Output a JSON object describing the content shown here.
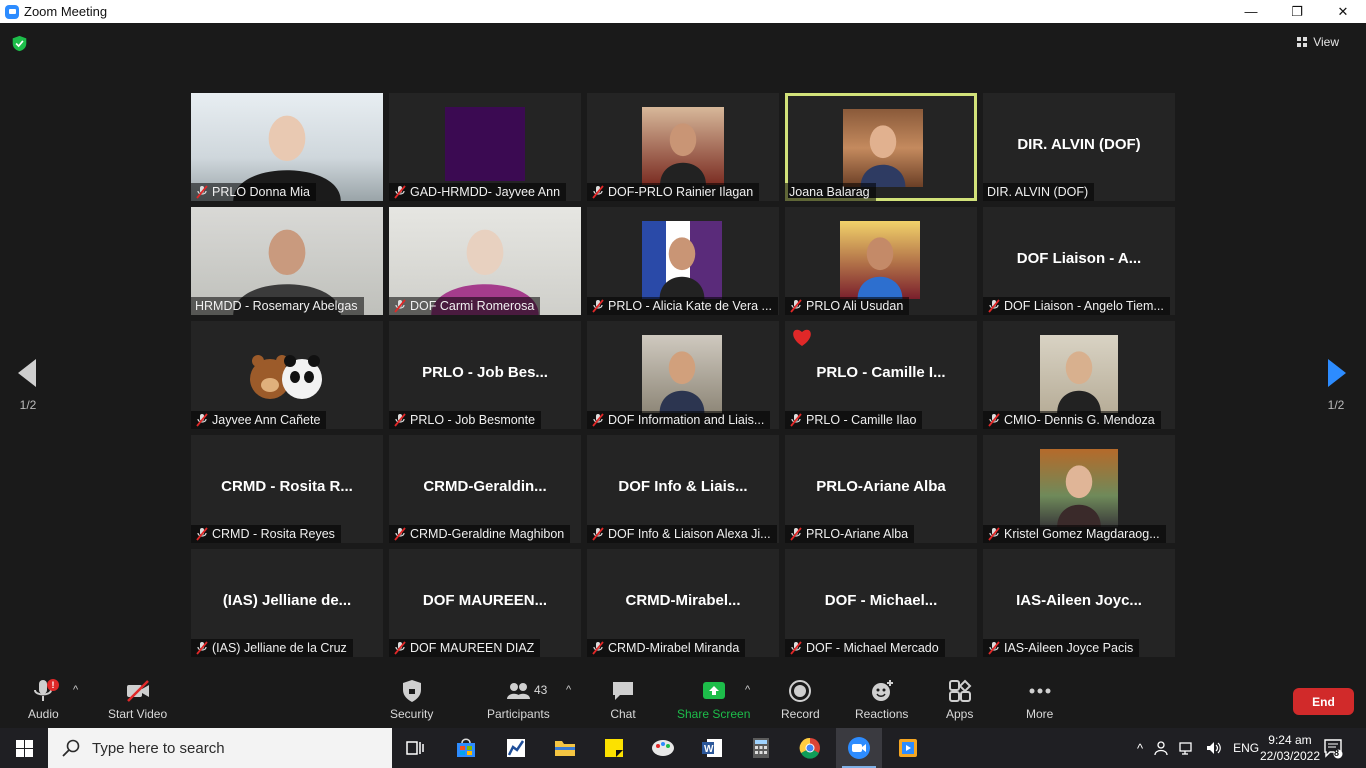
{
  "window": {
    "title": "Zoom Meeting",
    "minimize": "—",
    "restore": "❐",
    "close": "✕"
  },
  "top": {
    "view_label": "View"
  },
  "pager": {
    "left": "1/2",
    "right": "1/2"
  },
  "tiles": [
    {
      "name": "PRLO Donna Mia",
      "big": "",
      "muted": true
    },
    {
      "name": "GAD-HRMDD- Jayvee Ann",
      "big": "",
      "muted": true
    },
    {
      "name": "DOF-PRLO Rainier Ilagan",
      "big": "",
      "muted": true
    },
    {
      "name": "Joana Balarag",
      "big": "",
      "muted": false
    },
    {
      "name": "DIR. ALVIN (DOF)",
      "big": "DIR. ALVIN (DOF)",
      "muted": false
    },
    {
      "name": "HRMDD - Rosemary Abelgas",
      "big": "",
      "muted": false
    },
    {
      "name": "DOF Carmi Romerosa",
      "big": "",
      "muted": true
    },
    {
      "name": "PRLO - Alicia Kate de Vera ...",
      "big": "",
      "muted": true
    },
    {
      "name": "PRLO Ali Usudan",
      "big": "",
      "muted": true
    },
    {
      "name": "DOF Liaison - Angelo Tiem...",
      "big": "DOF Liaison - A...",
      "muted": true
    },
    {
      "name": "Jayvee Ann Cañete",
      "big": "",
      "muted": true
    },
    {
      "name": "PRLO - Job Besmonte",
      "big": "PRLO - Job Bes...",
      "muted": true
    },
    {
      "name": "DOF Information and Liais...",
      "big": "",
      "muted": true
    },
    {
      "name": "PRLO - Camille Ilao",
      "big": "PRLO - Camille I...",
      "muted": true
    },
    {
      "name": "CMIO- Dennis G. Mendoza",
      "big": "",
      "muted": true
    },
    {
      "name": "CRMD - Rosita Reyes",
      "big": "CRMD - Rosita R...",
      "muted": true
    },
    {
      "name": "CRMD-Geraldine Maghibon",
      "big": "CRMD-Geraldin...",
      "muted": true
    },
    {
      "name": "DOF Info & Liaison Alexa Ji...",
      "big": "DOF Info & Liais...",
      "muted": true
    },
    {
      "name": "PRLO-Ariane Alba",
      "big": "PRLO-Ariane Alba",
      "muted": true
    },
    {
      "name": "Kristel Gomez Magdaraog...",
      "big": "",
      "muted": true
    },
    {
      "name": "(IAS) Jelliane de la Cruz",
      "big": "(IAS) Jelliane de...",
      "muted": true
    },
    {
      "name": "DOF MAUREEN DIAZ",
      "big": "DOF  MAUREEN...",
      "muted": true
    },
    {
      "name": "CRMD-Mirabel Miranda",
      "big": "CRMD-Mirabel...",
      "muted": true
    },
    {
      "name": "DOF - Michael Mercado",
      "big": "DOF  -  Michael...",
      "muted": true
    },
    {
      "name": "IAS-Aileen Joyce Pacis",
      "big": "IAS-Aileen Joyc...",
      "muted": true
    }
  ],
  "toolbar": {
    "audio": "Audio",
    "audio_badge": "!",
    "start_video": "Start Video",
    "security": "Security",
    "participants": "Participants",
    "participants_count": "43",
    "chat": "Chat",
    "share_screen": "Share Screen",
    "record": "Record",
    "reactions": "Reactions",
    "apps": "Apps",
    "more": "More",
    "end": "End"
  },
  "taskbar": {
    "search_placeholder": "Type here to search",
    "language": "ENG",
    "time": "9:24 am",
    "date": "22/03/2022",
    "notification_count": "8"
  },
  "colors": {
    "accent_green": "#1dbd4a",
    "end_red": "#d12a2a",
    "active_speaker": "#d2e27a",
    "taskbar_blue": "#2d8cff"
  }
}
